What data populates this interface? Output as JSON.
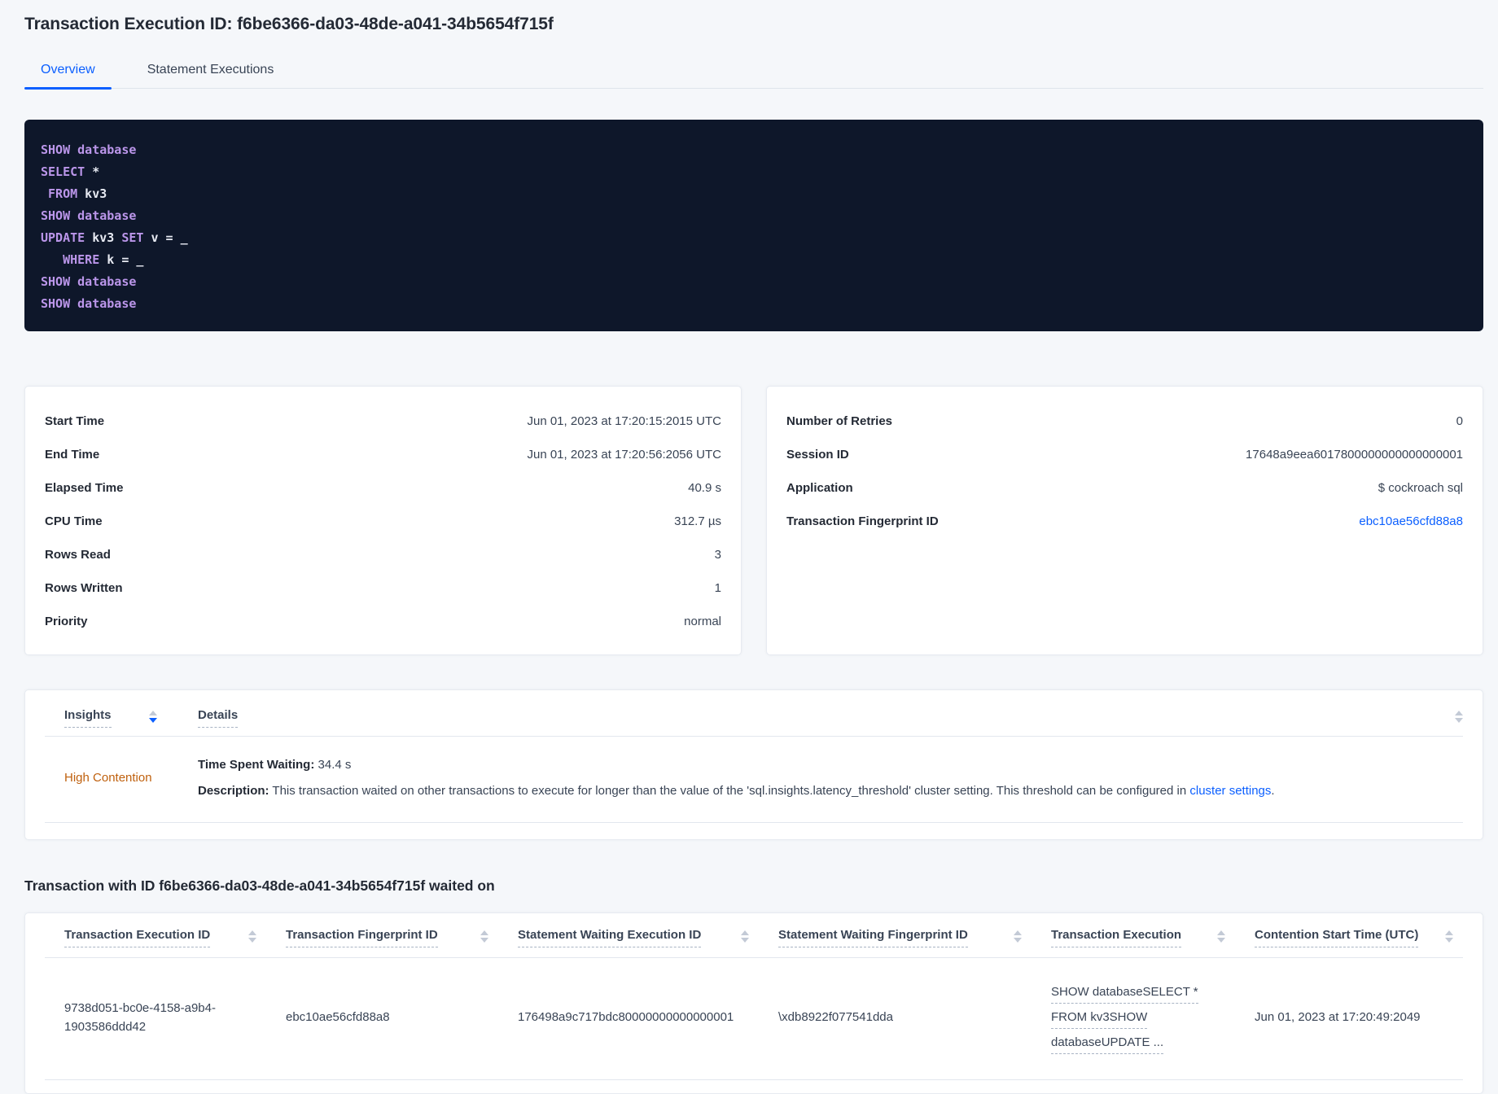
{
  "colors": {
    "accent_blue": "#0b5fff",
    "high_contention_orange": "#bf600d",
    "code_background": "#0e172a",
    "code_keyword_purple": "#bb96ea",
    "code_text": "#e7eaf2",
    "page_background": "#f5f7fa"
  },
  "header": {
    "title": "Transaction Execution ID: f6be6366-da03-48de-a041-34b5654f715f",
    "tabs": [
      {
        "label": "Overview",
        "active": true
      },
      {
        "label": "Statement Executions",
        "active": false
      }
    ]
  },
  "sql_preview": {
    "lines": [
      [
        {
          "t": "SHOW database",
          "kw": true
        }
      ],
      [
        {
          "t": "SELECT",
          "kw": true
        },
        {
          "t": " *",
          "kw": false
        }
      ],
      [
        {
          "t": " FROM",
          "kw": true
        },
        {
          "t": " kv3",
          "kw": false
        }
      ],
      [
        {
          "t": "SHOW database",
          "kw": true
        }
      ],
      [
        {
          "t": "UPDATE",
          "kw": true
        },
        {
          "t": " kv3 ",
          "kw": false
        },
        {
          "t": "SET",
          "kw": true
        },
        {
          "t": " v = _",
          "kw": false
        }
      ],
      [
        {
          "t": "   WHERE",
          "kw": true
        },
        {
          "t": " k = _",
          "kw": false
        }
      ],
      [
        {
          "t": "SHOW database",
          "kw": true
        }
      ],
      [
        {
          "t": "SHOW database",
          "kw": true
        }
      ]
    ]
  },
  "summary_left": {
    "rows": [
      {
        "label": "Start Time",
        "value": "Jun 01, 2023 at 17:20:15:2015 UTC"
      },
      {
        "label": "End Time",
        "value": "Jun 01, 2023 at 17:20:56:2056 UTC"
      },
      {
        "label": "Elapsed Time",
        "value": "40.9 s"
      },
      {
        "label": "CPU Time",
        "value": "312.7 µs"
      },
      {
        "label": "Rows Read",
        "value": "3"
      },
      {
        "label": "Rows Written",
        "value": "1"
      },
      {
        "label": "Priority",
        "value": "normal"
      }
    ]
  },
  "summary_right": {
    "rows": [
      {
        "label": "Number of Retries",
        "value": "0",
        "link": false
      },
      {
        "label": "Session ID",
        "value": "17648a9eea6017800000000000000001",
        "link": false
      },
      {
        "label": "Application",
        "value": "$ cockroach sql",
        "link": false
      },
      {
        "label": "Transaction Fingerprint ID",
        "value": "ebc10ae56cfd88a8",
        "link": true
      }
    ]
  },
  "insights": {
    "columns": [
      "Insights",
      "Details"
    ],
    "rows": [
      {
        "insight": "High Contention",
        "time_label": "Time Spent Waiting:",
        "time_value": "34.4 s",
        "desc_label": "Description:",
        "desc_text": "This transaction waited on other transactions to execute for longer than the value of the 'sql.insights.latency_threshold' cluster setting. This threshold can be configured in ",
        "desc_link": "cluster settings",
        "desc_suffix": "."
      }
    ]
  },
  "waited_on": {
    "heading": "Transaction with ID f6be6366-da03-48de-a041-34b5654f715f waited on",
    "columns": [
      "Transaction Execution ID",
      "Transaction Fingerprint ID",
      "Statement Waiting Execution ID",
      "Statement Waiting Fingerprint ID",
      "Transaction Execution",
      "Contention Start Time (UTC)"
    ],
    "row": {
      "transaction_execution_id": "9738d051-bc0e-4158-a9b4-1903586ddd42",
      "transaction_fingerprint_id": "ebc10ae56cfd88a8",
      "statement_waiting_execution_id": "176498a9c717bdc80000000000000001",
      "statement_waiting_fingerprint_id": "\\xdb8922f077541dda",
      "transaction_execution_lines": [
        "SHOW databaseSELECT *",
        "FROM kv3SHOW",
        "databaseUPDATE ..."
      ],
      "contention_start_time": "Jun 01, 2023 at 17:20:49:2049"
    }
  }
}
